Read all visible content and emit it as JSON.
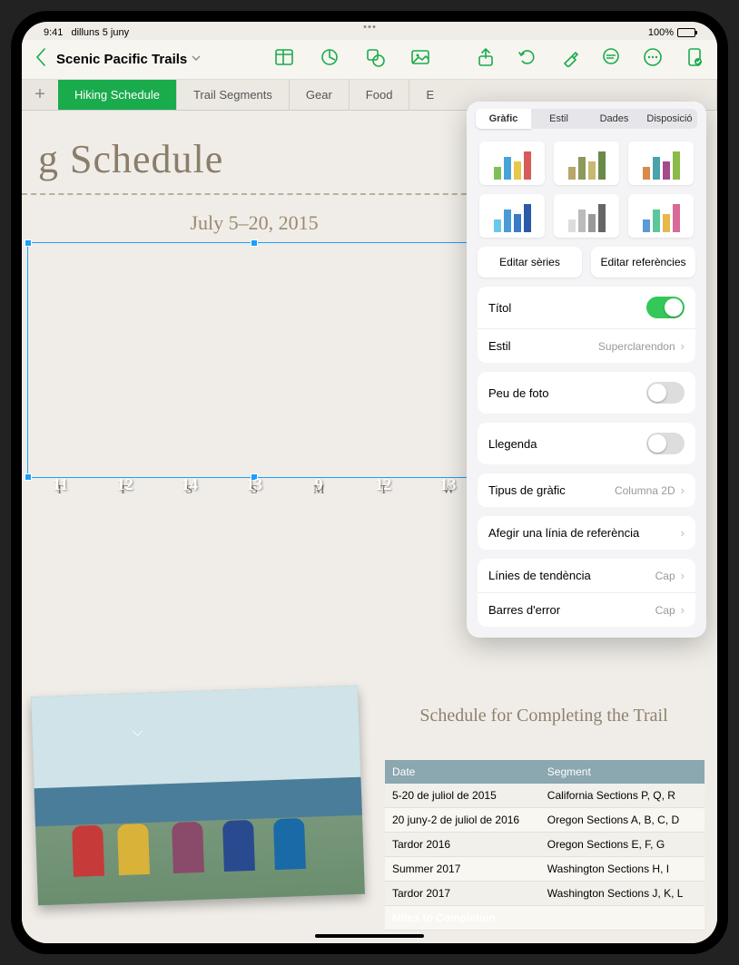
{
  "status": {
    "time": "9:41",
    "date": "dilluns 5 juny",
    "battery": "100%"
  },
  "doc": {
    "title": "Scenic Pacific Trails"
  },
  "tabs": [
    "Hiking Schedule",
    "Trail Segments",
    "Gear",
    "Food",
    "E"
  ],
  "page_title_cropped": "g Schedule",
  "chart_data": {
    "type": "bar",
    "title": "July 5–20, 2015",
    "categories": [
      "T",
      "F",
      "S",
      "S",
      "M",
      "T",
      "W"
    ],
    "values": [
      11,
      12,
      14,
      13,
      9,
      12,
      13
    ],
    "ylim": [
      0,
      16
    ]
  },
  "schedule": {
    "title": "Schedule for Completing the Trail",
    "headers": [
      "Date",
      "Segment"
    ],
    "rows": [
      [
        "5-20 de juliol de 2015",
        "California Sections P, Q, R"
      ],
      [
        "20 juny-2 de juliol de 2016",
        "Oregon Sections A, B, C, D"
      ],
      [
        "Tardor 2016",
        "Oregon Sections E, F, G"
      ],
      [
        "Summer 2017",
        "Washington Sections H, I"
      ],
      [
        "Tardor 2017",
        "Washington Sections J, K, L"
      ]
    ],
    "footer": "Miles to Completion"
  },
  "popover": {
    "segments": [
      "Gràfic",
      "Estil",
      "Dades",
      "Disposició"
    ],
    "edit_series": "Editar sèries",
    "edit_refs": "Editar referències",
    "title_label": "Títol",
    "style_label": "Estil",
    "style_value": "Superclarendon",
    "caption_label": "Peu de foto",
    "legend_label": "Llegenda",
    "chart_type_label": "Tipus de gràfic",
    "chart_type_value": "Columna 2D",
    "add_ref_line": "Afegir una línia de referència",
    "trendlines_label": "Línies de tendència",
    "trendlines_value": "Cap",
    "error_bars_label": "Barres d'error",
    "error_bars_value": "Cap"
  }
}
